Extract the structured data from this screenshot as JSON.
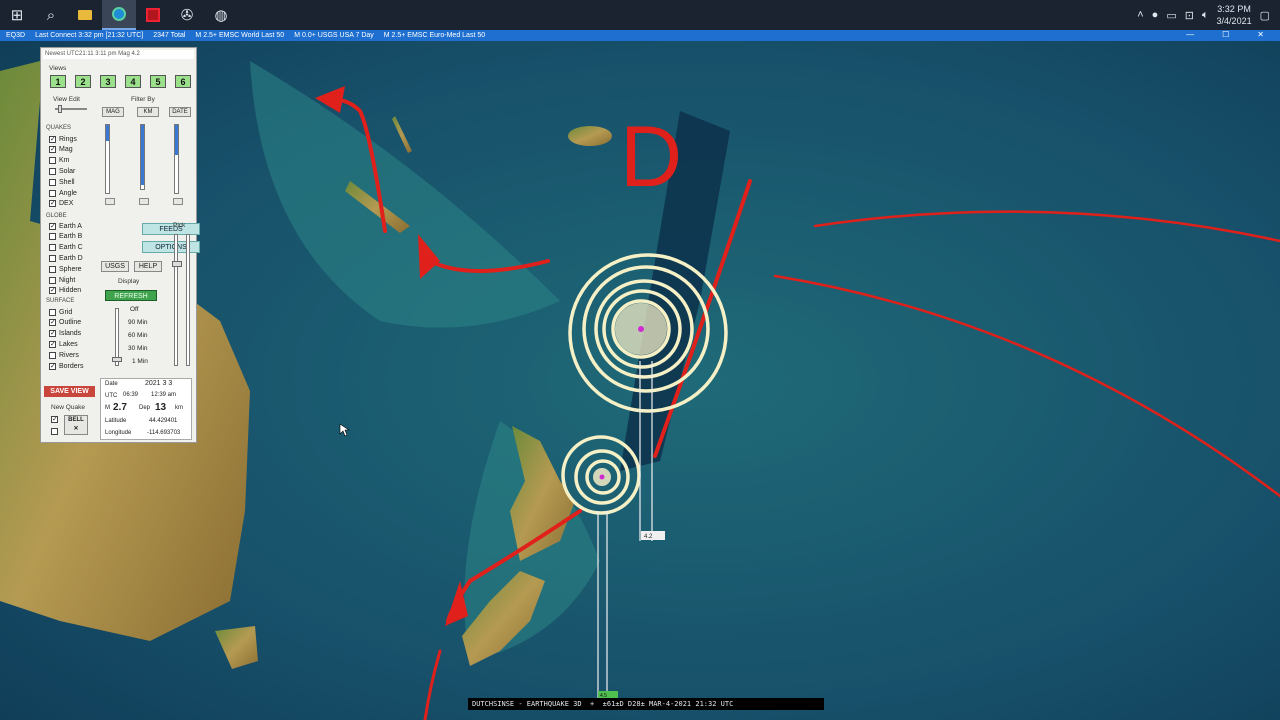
{
  "taskbar": {
    "icons": [
      "windows-start-icon",
      "search-icon",
      "file-explorer-icon",
      "edge-browser-icon",
      "red-app-icon",
      "settings-wheel-icon",
      "globe-app-icon"
    ],
    "time": "3:32 PM",
    "date": "3/4/2021"
  },
  "titlebar": {
    "app": "EQ3D",
    "last_connect": "Last Connect 3:32 pm [21:32 UTC]",
    "total": "2347 Total",
    "feed1": "M 2.5+ EMSC World Last 50",
    "feed2": "M 0.0+ USGS USA 7 Day",
    "feed3": "M 2.5+ EMSC Euro-Med Last 50"
  },
  "panel": {
    "newest": "Newest UTC21:11 3:11 pm Mag 4.2",
    "views_label": "Views",
    "views": [
      "1",
      "2",
      "3",
      "4",
      "5",
      "6"
    ],
    "view_edit_label": "View Edit",
    "filter_by_label": "Filter By",
    "filters": [
      "MAG",
      "KM",
      "DATE"
    ],
    "quakes_label": "QUAKES",
    "quakes": [
      {
        "label": "Rings",
        "checked": true
      },
      {
        "label": "Mag",
        "checked": true
      },
      {
        "label": "Km",
        "checked": false
      },
      {
        "label": "Solar",
        "checked": false
      },
      {
        "label": "Shell",
        "checked": false
      },
      {
        "label": "Angle",
        "checked": false
      },
      {
        "label": "DEX",
        "checked": true
      }
    ],
    "globe_label": "GLOBE",
    "globe": [
      {
        "label": "Earth A",
        "checked": true
      },
      {
        "label": "Earth B",
        "checked": false
      },
      {
        "label": "Earth C",
        "checked": false
      },
      {
        "label": "Earth D",
        "checked": false
      },
      {
        "label": "Sphere",
        "checked": false
      },
      {
        "label": "Night",
        "checked": false
      },
      {
        "label": "Hidden",
        "checked": true
      }
    ],
    "surface_label": "SURFACE",
    "surface": [
      {
        "label": "Grid",
        "checked": false
      },
      {
        "label": "Outline",
        "checked": true
      },
      {
        "label": "Islands",
        "checked": true
      },
      {
        "label": "Lakes",
        "checked": true
      },
      {
        "label": "Rivers",
        "checked": false
      },
      {
        "label": "Borders",
        "checked": true
      }
    ],
    "buttons": {
      "feeds": "FEEDS",
      "options": "OPTIONS",
      "usgs": "USGS",
      "help": "HELP",
      "refresh": "REFRESH",
      "save_view": "SAVE VIEW",
      "bell": "BELL"
    },
    "display_label": "Display",
    "pick_label": "Pick",
    "times": [
      "Off",
      "90 Min",
      "60 Min",
      "30 Min",
      "1 Min"
    ],
    "new_quake_label": "New Quake",
    "info": {
      "date_label": "Date",
      "date": "2021 3 3",
      "utc_label": "UTC",
      "utc": "06:39",
      "local": "12:39 am",
      "mag_label": "M",
      "mag": "2.7",
      "dep_label": "Dep",
      "dep": "13",
      "dep_unit": "km",
      "lat_label": "Latitude",
      "lat": "44.429401",
      "lon_label": "Longitude",
      "lon": "-114.693703"
    }
  },
  "map": {
    "annotation_letter": "D",
    "quake_label_1": "4.2",
    "quake_label_2": "4.5"
  },
  "bottom_bar": "DUTCHSINSE - EARTHQUAKE 3D  +  ±61±D D28± MAR-4-2021 21:32 UTC",
  "colors": {
    "arrow": "#e0201a",
    "ring": "#f6f0c6",
    "panel_green": "#9be08a",
    "titlebar": "#1e6fcf"
  }
}
